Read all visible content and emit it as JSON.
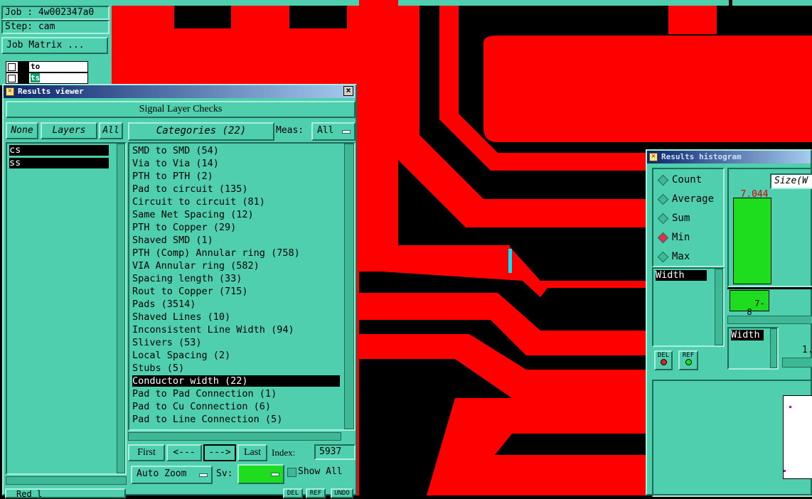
{
  "job_panel": {
    "job": "Job : 4w002347a0",
    "step": "Step: cam",
    "job_matrix_button": "Job Matrix ...",
    "layer_rows": [
      "to",
      "ts"
    ]
  },
  "results_viewer": {
    "title": "Results viewer",
    "close_symbol": "×",
    "check_title": "Signal Layer Checks",
    "none_button": "None",
    "layers_button": "Layers",
    "all_button": "All",
    "layers": [
      "cs",
      "ss"
    ],
    "categories_button": "Categories (22)",
    "meas_label": "Meas:",
    "meas_value": "All",
    "categories": [
      "SMD to SMD (54)",
      "Via to Via (14)",
      "PTH to PTH (2)",
      "Pad to circuit (135)",
      "Circuit to circuit (81)",
      "Same Net Spacing (12)",
      "PTH to Copper (29)",
      "Shaved SMD (1)",
      "PTH (Comp) Annular ring (758)",
      "VIA Annular ring (582)",
      "Spacing length (33)",
      "Rout to Copper (715)",
      "Pads (3514)",
      "Shaved Lines (10)",
      "Inconsistent Line Width (94)",
      "Slivers (53)",
      "Local Spacing (2)",
      "Stubs (5)",
      "Conductor width (22)",
      "Pad to Pad Connection (1)",
      "Pad to Cu Connection (6)",
      "Pad to Line Connection (5)"
    ],
    "selected_category_index": 18,
    "first_button": "First",
    "prev_button": "<---",
    "next_button": "--->",
    "last_button": "Last",
    "index_label": "Index:",
    "index_value": "5937",
    "auto_zoom_label": "Auto Zoom",
    "sv_label": "Sv:",
    "show_all_label": "Show All",
    "bottom_buttons": [
      "DEL",
      "REF",
      "UNDO"
    ],
    "bottom_left_text": "Red   l"
  },
  "results_histogram": {
    "title": "Results histogram",
    "modes": [
      "Count",
      "Average",
      "Sum",
      "Min",
      "Max"
    ],
    "selected_mode": "Min",
    "size_label": "Size(W",
    "bar_value": "7.044",
    "bar_label": "7-\n8",
    "attr_list": [
      "Width"
    ],
    "del_button": "DEL",
    "ref_button": "REF",
    "attr_list2": [
      "Width"
    ],
    "slider_value": "1."
  },
  "colors": {
    "copper": "#ff0000",
    "panel": "#4fcfae",
    "bar": "#1edc1e",
    "marker": "#00e5ff"
  }
}
